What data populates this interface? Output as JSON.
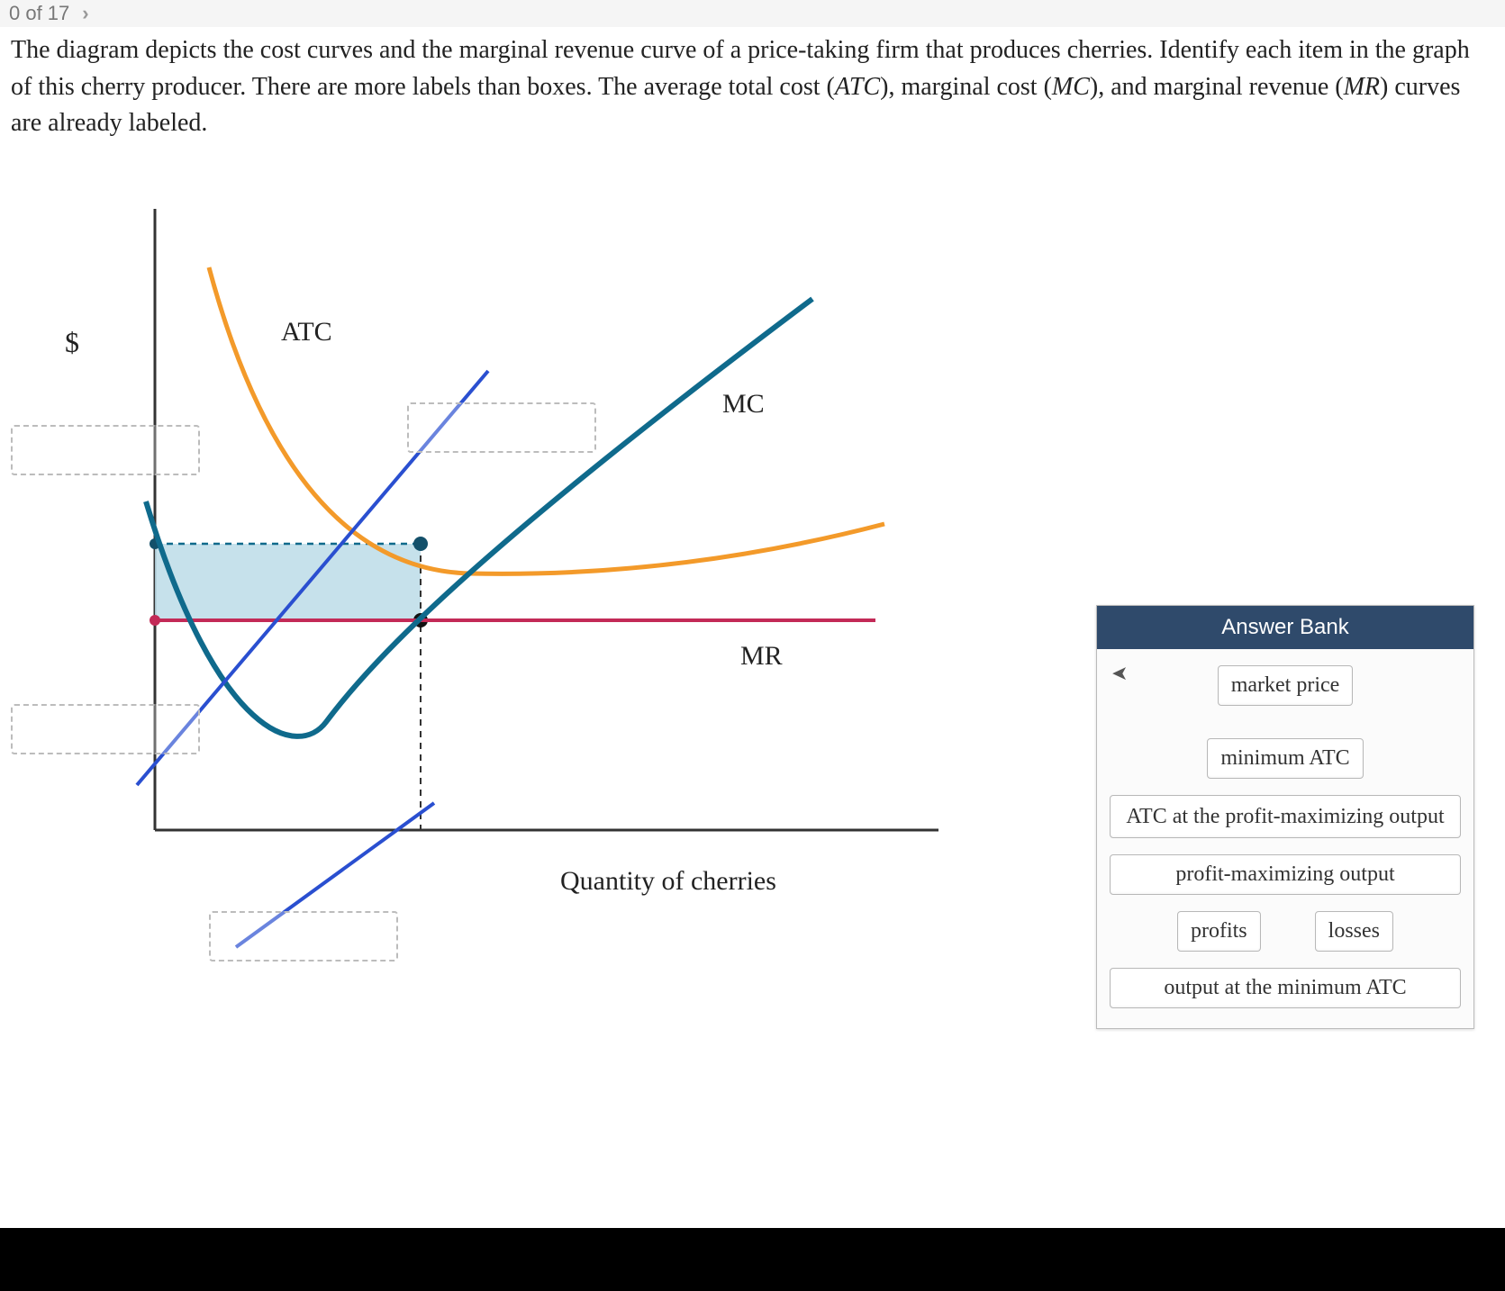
{
  "header": {
    "progress": "0 of 17",
    "chevron": "›"
  },
  "question": {
    "text_pre": "The diagram depicts the cost curves and the marginal revenue curve of a price-taking firm that produces cherries. Identify each item in the graph of this cherry producer. There are more labels than boxes. The average total cost (",
    "atc": "ATC",
    "text_mid1": "), marginal cost (",
    "mc": "MC",
    "text_mid2": "), and marginal revenue (",
    "mr": "MR",
    "text_end": ") curves are already labeled."
  },
  "chart": {
    "y_axis": "$",
    "x_axis": "Quantity of cherries",
    "labels": {
      "atc": "ATC",
      "mc": "MC",
      "mr": "MR"
    }
  },
  "answer_bank": {
    "title": "Answer Bank",
    "items": {
      "market_price": "market price",
      "minimum_atc": "minimum ATC",
      "atc_at_pm": "ATC at the profit-maximizing output",
      "pm_output": "profit-maximizing output",
      "profits": "profits",
      "losses": "losses",
      "output_min_atc": "output at the minimum ATC"
    }
  },
  "chart_data": {
    "type": "line",
    "title": "Cost curves of a price-taking cherry producer",
    "xlabel": "Quantity of cherries",
    "ylabel": "$",
    "xlim": [
      0,
      100
    ],
    "ylim": [
      0,
      100
    ],
    "series": [
      {
        "name": "ATC",
        "color": "#f39a2a",
        "x": [
          10,
          15,
          20,
          25,
          30,
          35,
          40,
          50,
          60,
          80,
          100
        ],
        "y": [
          95,
          78,
          62,
          50,
          42,
          37,
          35,
          36,
          39,
          44,
          48
        ]
      },
      {
        "name": "MC",
        "color": "#0f6a8c",
        "x": [
          5,
          10,
          15,
          20,
          25,
          30,
          35,
          45,
          55,
          70,
          90,
          100
        ],
        "y": [
          48,
          30,
          15,
          8,
          10,
          18,
          28,
          40,
          50,
          62,
          78,
          86
        ]
      },
      {
        "name": "MR",
        "color": "#c32a57",
        "x": [
          0,
          100
        ],
        "y": [
          28,
          28
        ]
      }
    ],
    "annotations": {
      "profit_maximizing_output_x": 35,
      "mr_price_level_y": 28,
      "atc_at_pm_output_y": 37,
      "shaded_region": {
        "x_range": [
          0,
          35
        ],
        "y_range": [
          28,
          37
        ],
        "meaning": "losses"
      }
    }
  }
}
